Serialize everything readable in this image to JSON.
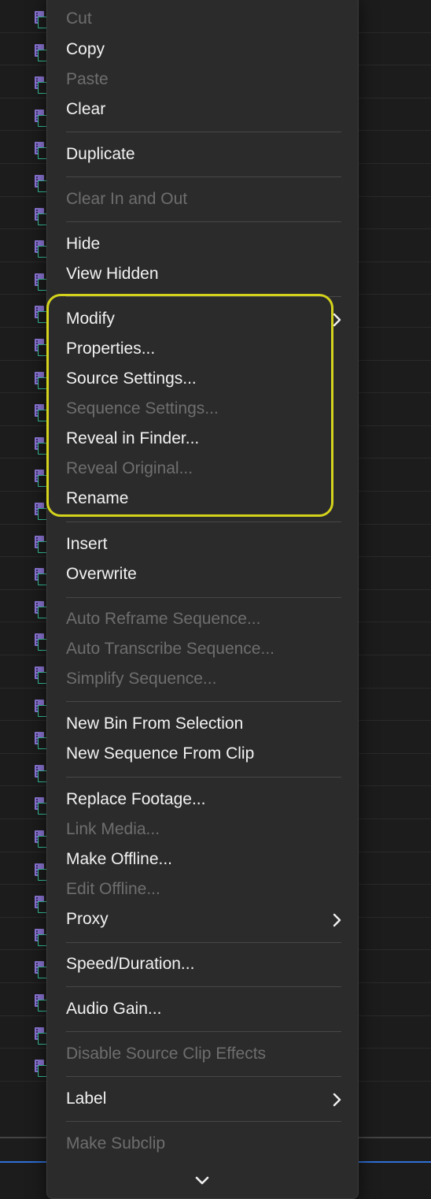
{
  "menu": {
    "items": [
      {
        "label": "Cut",
        "enabled": false,
        "submenu": false,
        "top": 0
      },
      {
        "label": "Copy",
        "enabled": true,
        "submenu": false
      },
      {
        "label": "Paste",
        "enabled": false,
        "submenu": false
      },
      {
        "label": "Clear",
        "enabled": true,
        "submenu": false
      },
      {
        "label": "Duplicate",
        "enabled": true,
        "submenu": false
      },
      {
        "label": "Clear In and Out",
        "enabled": false,
        "submenu": false
      },
      {
        "label": "Hide",
        "enabled": true,
        "submenu": false
      },
      {
        "label": "View Hidden",
        "enabled": true,
        "submenu": false
      },
      {
        "label": "Modify",
        "enabled": true,
        "submenu": true
      },
      {
        "label": "Properties...",
        "enabled": true,
        "submenu": false
      },
      {
        "label": "Source Settings...",
        "enabled": true,
        "submenu": false
      },
      {
        "label": "Sequence Settings...",
        "enabled": false,
        "submenu": false
      },
      {
        "label": "Reveal in Finder...",
        "enabled": true,
        "submenu": false
      },
      {
        "label": "Reveal Original...",
        "enabled": false,
        "submenu": false
      },
      {
        "label": "Rename",
        "enabled": true,
        "submenu": false
      },
      {
        "label": "Insert",
        "enabled": true,
        "submenu": false
      },
      {
        "label": "Overwrite",
        "enabled": true,
        "submenu": false
      },
      {
        "label": "Auto Reframe Sequence...",
        "enabled": false,
        "submenu": false
      },
      {
        "label": "Auto Transcribe Sequence...",
        "enabled": false,
        "submenu": false
      },
      {
        "label": "Simplify Sequence...",
        "enabled": false,
        "submenu": false
      },
      {
        "label": "New Bin From Selection",
        "enabled": true,
        "submenu": false
      },
      {
        "label": "New Sequence From Clip",
        "enabled": true,
        "submenu": false
      },
      {
        "label": "Replace Footage...",
        "enabled": true,
        "submenu": false
      },
      {
        "label": "Link Media...",
        "enabled": false,
        "submenu": false
      },
      {
        "label": "Make Offline...",
        "enabled": true,
        "submenu": false
      },
      {
        "label": "Edit Offline...",
        "enabled": false,
        "submenu": false
      },
      {
        "label": "Proxy",
        "enabled": true,
        "submenu": true
      },
      {
        "label": "Speed/Duration...",
        "enabled": true,
        "submenu": false
      },
      {
        "label": "Audio Gain...",
        "enabled": true,
        "submenu": false
      },
      {
        "label": "Disable Source Clip Effects",
        "enabled": false,
        "submenu": false
      },
      {
        "label": "Label",
        "enabled": true,
        "submenu": true
      },
      {
        "label": "Make Subclip",
        "enabled": false,
        "submenu": false
      }
    ]
  },
  "colors": {
    "menu_background": "#2b2b2c",
    "enabled_text": "#f2f2f2",
    "disabled_text": "#6e6e6e",
    "highlight_outline": "#d4d31c",
    "clip_icon_purple": "#8e78d8",
    "clip_icon_green": "#38c9a0"
  },
  "icons": {
    "submenu": "chevron-right-icon",
    "scroll_more": "chevron-down-icon",
    "clip": "clip-icon"
  }
}
